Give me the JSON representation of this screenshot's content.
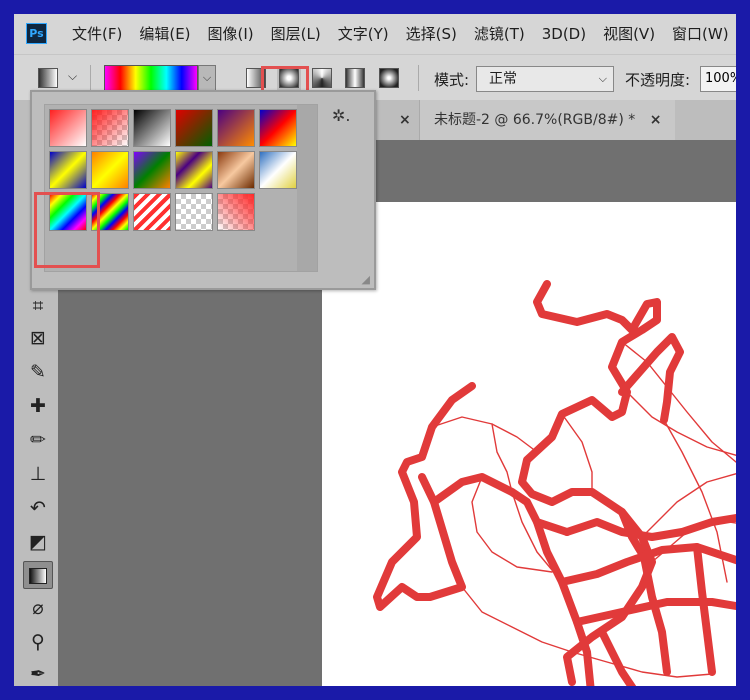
{
  "app": {
    "logo_text": "Ps"
  },
  "menu": {
    "items": [
      "文件(F)",
      "编辑(E)",
      "图像(I)",
      "图层(L)",
      "文字(Y)",
      "选择(S)",
      "滤镜(T)",
      "3D(D)",
      "视图(V)",
      "窗口(W)"
    ]
  },
  "options": {
    "mode_label": "模式:",
    "mode_value": "正常",
    "opacity_label": "不透明度:",
    "opacity_value": "100%"
  },
  "tabs": {
    "tab1_suffix": "* ",
    "tab1_close": "×",
    "tab2_label": "未标题-2 @ 66.7%(RGB/8#) *",
    "tab2_close": "×"
  },
  "sidebar": {
    "collapse_glyph": "»"
  },
  "gradient_presets": {
    "gear_icon_glyph": "✲.",
    "resize_glyph": "◢"
  },
  "colors": {
    "highlight": "#e35050",
    "drawing_stroke": "#e13a3a",
    "frame_border": "#1a1aa8"
  }
}
